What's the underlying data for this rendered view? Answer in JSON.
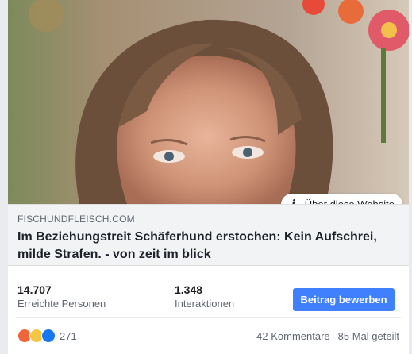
{
  "link_preview": {
    "domain": "FISCHUNDFLEISCH.COM",
    "headline": "Im Beziehungstreit Schäferhund erstochen: Kein Aufschrei, milde Strafen. - von zeit im blick",
    "about_label": "Über diese Website",
    "about_icon": "info-icon"
  },
  "stats": {
    "reach_value": "14.707",
    "reach_label": "Erreichte Personen",
    "interactions_value": "1.348",
    "interactions_label": "Interaktionen",
    "boost_label": "Beitrag bewerben",
    "boost_color": "#4080ff"
  },
  "footer": {
    "reaction_icons": [
      "angry-reaction-icon",
      "sad-reaction-icon",
      "like-reaction-icon"
    ],
    "reaction_count": "271",
    "comments": "42 Kommentare",
    "shares": "85 Mal geteilt"
  }
}
